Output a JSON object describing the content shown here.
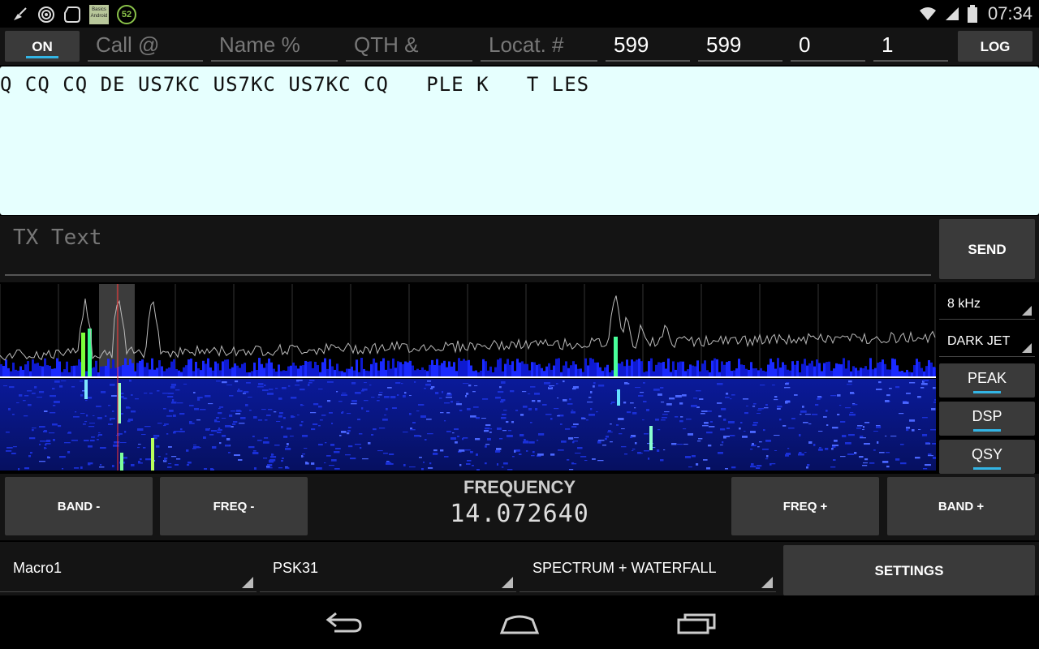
{
  "status_bar": {
    "notification_icons": [
      "broom-icon",
      "target-icon",
      "rounded-square-icon",
      "basics-android-icon",
      "badge-52-icon"
    ],
    "basics_label": "Basics Android",
    "badge_number": "52",
    "time": "07:34"
  },
  "qso": {
    "on_label": "ON",
    "call_placeholder": "Call @",
    "name_placeholder": "Name %",
    "qth_placeholder": "QTH &",
    "locator_placeholder": "Locat. #",
    "rst_sent": "599",
    "rst_received": "599",
    "field_0": "0",
    "field_1": "1",
    "log_label": "LOG"
  },
  "rx": {
    "text": "Q CQ CQ DE US7KC US7KC US7KC CQ   PLE K   T LES"
  },
  "tx": {
    "placeholder": "TX Text",
    "send_label": "SEND"
  },
  "scope": {
    "span_label": "8 kHz",
    "palette_label": "DARK JET",
    "peak_label": "PEAK",
    "dsp_label": "DSP",
    "qsy_label": "QSY"
  },
  "frequency": {
    "title": "FREQUENCY",
    "value": "14.072640",
    "band_minus": "BAND -",
    "freq_minus": "FREQ -",
    "freq_plus": "FREQ +",
    "band_plus": "BAND +"
  },
  "selectors": {
    "macro": "Macro1",
    "mode": "PSK31",
    "view": "SPECTRUM + WATERFALL",
    "settings_label": "SETTINGS"
  },
  "colors": {
    "accent": "#33b5e5",
    "rx_background": "#e6fffe",
    "button_bg": "#3a3a3a",
    "waterfall_blue": "#1020c0"
  }
}
